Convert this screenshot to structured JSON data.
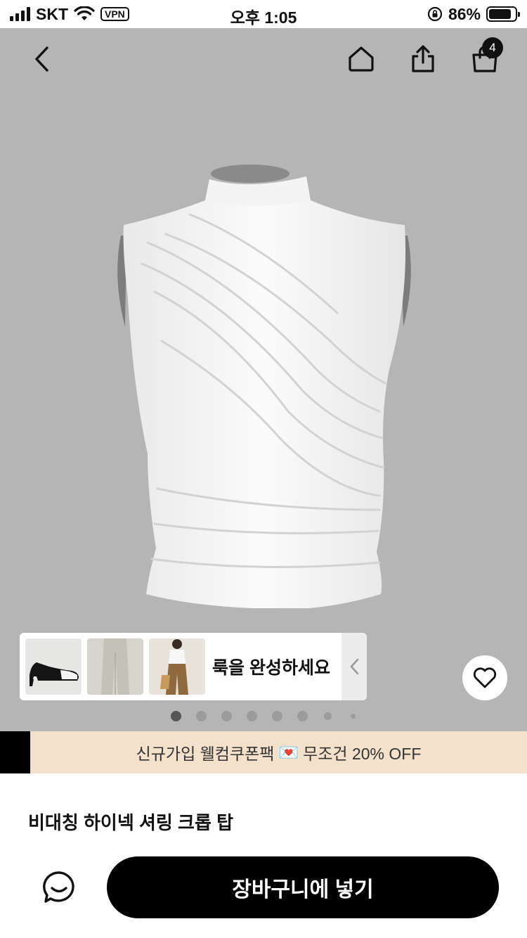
{
  "status_bar": {
    "carrier": "SKT",
    "vpn": "VPN",
    "time": "오후 1:05",
    "battery": "86%",
    "battery_level": 0.86
  },
  "header": {
    "cart_count": "4",
    "icons": [
      "back-icon",
      "home-icon",
      "share-icon",
      "shopping-bag-icon"
    ]
  },
  "look": {
    "label": "룩을 완성하세요"
  },
  "gallery": {
    "dot_count": 8,
    "active_index": 0
  },
  "promo": {
    "text_before": "신규가입 웰컴쿠폰팩",
    "emoji": "💌",
    "text_after": "무조건 20% OFF"
  },
  "product": {
    "title": "비대칭 하이넥 셔링 크롭 탑"
  },
  "actions": {
    "add_to_cart": "장바구니에 넣기"
  },
  "colors": {
    "hero_bg": "#b5b5b5",
    "promo_bg": "#f4e1cb",
    "primary": "#000000"
  }
}
